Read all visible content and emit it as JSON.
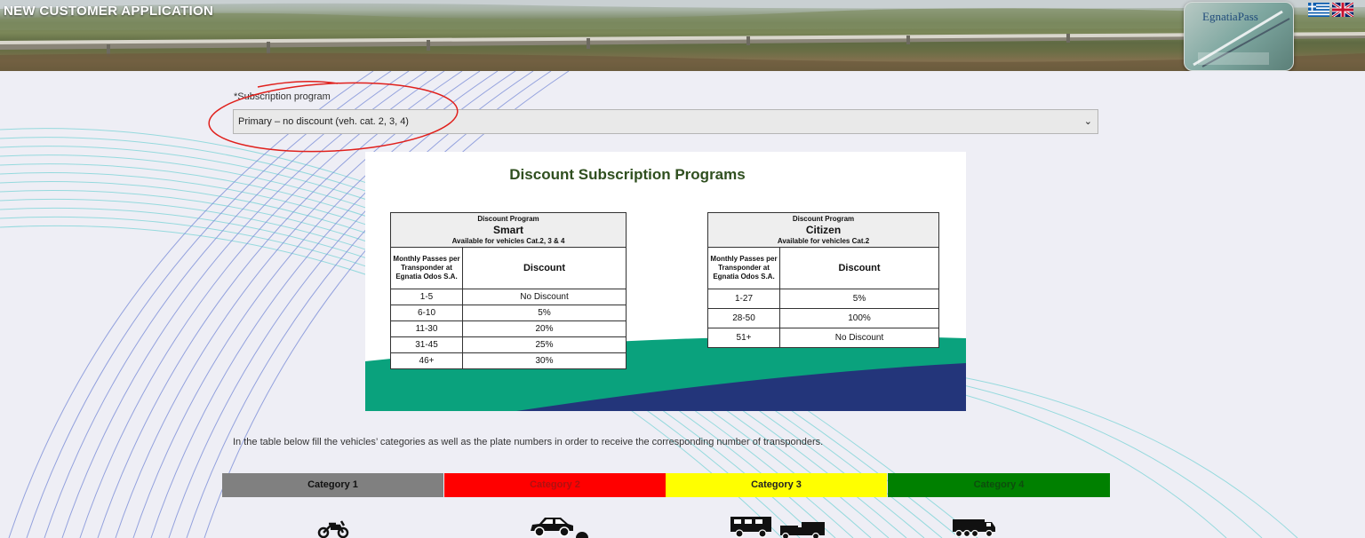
{
  "header": {
    "title": "New customer application",
    "logo_text": "EgnatiaPass",
    "languages": [
      "greek-flag",
      "english-flag"
    ]
  },
  "subscription": {
    "label": "*Subscription program",
    "selected": "Primary – no discount (veh. cat. 2, 3, 4)"
  },
  "discount_panel": {
    "title": "Discount Subscription Programs",
    "tables": [
      {
        "header_small": "Discount Program",
        "name": "Smart",
        "availability": "Available for vehicles Cat.2, 3 & 4",
        "col1": "Monthly Passes per Transponder at Egnatia Odos S.A.",
        "col2": "Discount",
        "rows": [
          {
            "passes": "1-5",
            "discount": "No Discount"
          },
          {
            "passes": "6-10",
            "discount": "5%"
          },
          {
            "passes": "11-30",
            "discount": "20%"
          },
          {
            "passes": "31-45",
            "discount": "25%"
          },
          {
            "passes": "46+",
            "discount": "30%"
          }
        ]
      },
      {
        "header_small": "Discount Program",
        "name": "Citizen",
        "availability": "Available for vehicles Cat.2",
        "col1": "Monthly Passes per Transponder at Egnatia Odos S.A.",
        "col2": "Discount",
        "rows": [
          {
            "passes": "1-27",
            "discount": "5%"
          },
          {
            "passes": "28-50",
            "discount": "100%"
          },
          {
            "passes": "51+",
            "discount": "No Discount"
          }
        ]
      }
    ]
  },
  "instruction": "In the table below fill the vehicles’ categories as well as the plate numbers in order to receive the corresponding number of transponders.",
  "categories": [
    {
      "label": "Category 1",
      "color": "#808080",
      "icon": "motorcycle-icon"
    },
    {
      "label": "Category 2",
      "color": "#ff0000",
      "icon": "car-icon"
    },
    {
      "label": "Category 3",
      "color": "#ffff00",
      "icon": "truck-icon"
    },
    {
      "label": "Category 4",
      "color": "#008000",
      "icon": "heavy-truck-icon"
    }
  ]
}
